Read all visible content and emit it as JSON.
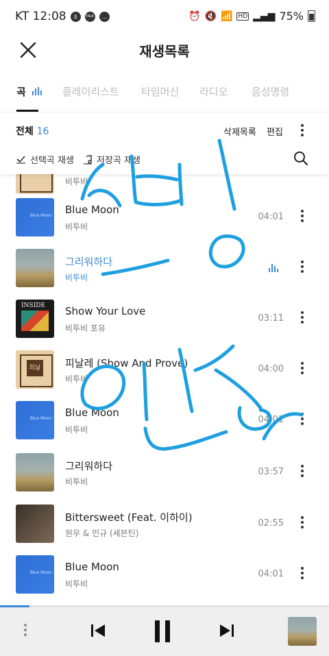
{
  "status_bar": {
    "carrier_time": "KT 12:08",
    "talk_icon_text": "TALK",
    "hd_label": "HD",
    "battery": "75%"
  },
  "header": {
    "title": "재생목록"
  },
  "tabs": [
    {
      "label": "곡",
      "active": true
    },
    {
      "label": "플레이리스트"
    },
    {
      "label": "타임머신"
    },
    {
      "label": "라디오"
    },
    {
      "label": "음성명령"
    }
  ],
  "toolbar": {
    "all_label": "전체",
    "count": "16",
    "delete_label": "삭제목록",
    "edit_label": "편집"
  },
  "actions": {
    "play_selected": "선택곡 재생",
    "play_saved": "저장곡 재생"
  },
  "partial_row": {
    "artist": "비투비"
  },
  "songs": [
    {
      "title": "Blue Moon",
      "artist": "비투비",
      "duration": "04:01",
      "art": "blue"
    },
    {
      "title": "그리워하다",
      "artist": "비투비",
      "duration": "",
      "art": "field",
      "playing": true
    },
    {
      "title": "Show Your Love",
      "artist": "비투비 포유",
      "duration": "03:11",
      "art": "inside"
    },
    {
      "title": "피날레 (Show And Prove)",
      "artist": "비투비",
      "duration": "04:00",
      "art": "gold"
    },
    {
      "title": "Blue Moon",
      "artist": "비투비",
      "duration": "04:01",
      "art": "blue"
    },
    {
      "title": "그리워하다",
      "artist": "비투비",
      "duration": "03:57",
      "art": "field"
    },
    {
      "title": "Bittersweet (Feat. 이하이)",
      "artist": "원우 & 민규 (세븐틴)",
      "duration": "02:55",
      "art": "dark"
    },
    {
      "title": "Blue Moon",
      "artist": "비투비",
      "duration": "04:01",
      "art": "blue"
    }
  ],
  "album_art_text": {
    "inside": "INSIDE",
    "finale": "피날레",
    "bluemoon": "Blue Moon"
  },
  "player": {
    "progress_fraction": 0.09
  },
  "colors": {
    "accent": "#3b88d8",
    "scribble": "#1ea0e0"
  },
  "icons": [
    "close-icon",
    "equalizer-icon",
    "more-vert-icon",
    "check-icon",
    "music-note-icon",
    "search-icon",
    "previous-icon",
    "pause-icon",
    "next-icon"
  ]
}
